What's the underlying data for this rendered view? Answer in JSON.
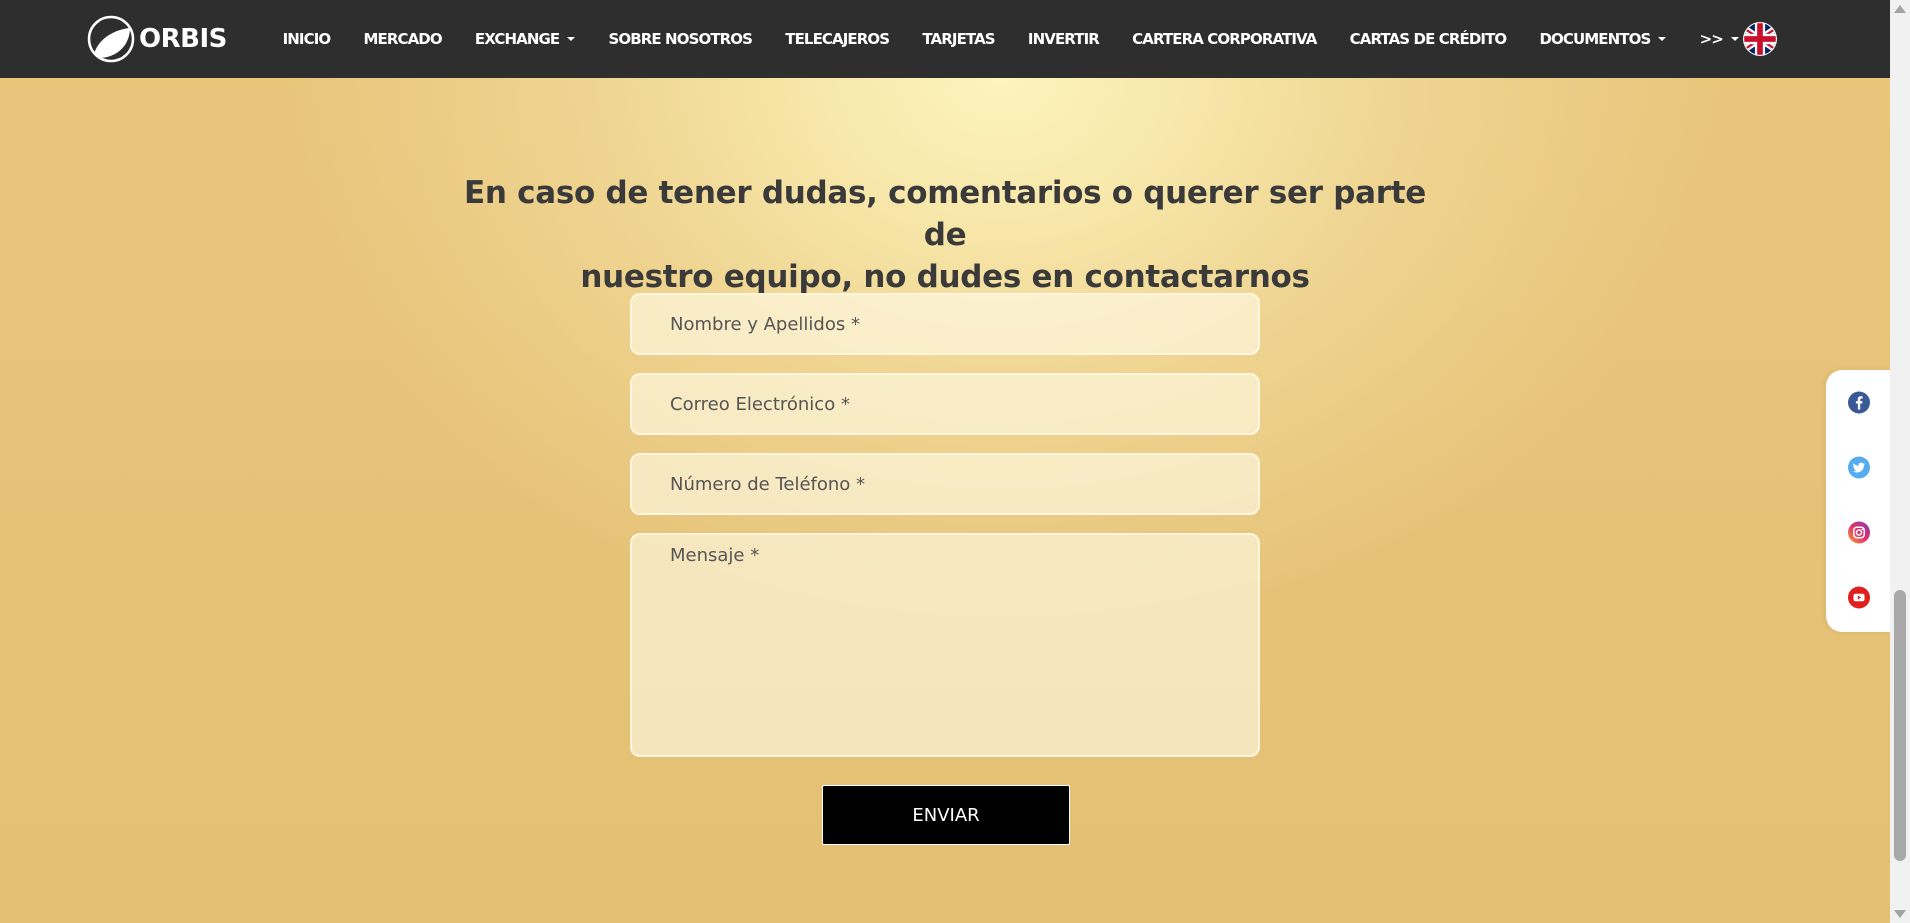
{
  "brand": {
    "name": "ORBIS"
  },
  "nav": {
    "items": [
      {
        "label": "INICIO",
        "dropdown": false
      },
      {
        "label": "MERCADO",
        "dropdown": false
      },
      {
        "label": "EXCHANGE",
        "dropdown": true
      },
      {
        "label": "SOBRE NOSOTROS",
        "dropdown": false
      },
      {
        "label": "TELECAJEROS",
        "dropdown": false
      },
      {
        "label": "TARJETAS",
        "dropdown": false
      },
      {
        "label": "INVERTIR",
        "dropdown": false
      },
      {
        "label": "CARTERA CORPORATIVA",
        "dropdown": false
      },
      {
        "label": "CARTAS DE CRÉDITO",
        "dropdown": false
      },
      {
        "label": "DOCUMENTOS",
        "dropdown": true
      },
      {
        "label": ">>",
        "dropdown": true
      }
    ],
    "language_icon": "uk-flag-icon"
  },
  "contact": {
    "heading_line1": "En caso de tener dudas, comentarios o querer ser parte de",
    "heading_line2": "nuestro equipo, no dudes en contactarnos",
    "name_placeholder": "Nombre y Apellidos *",
    "email_placeholder": "Correo Electrónico *",
    "phone_placeholder": "Número de Teléfono *",
    "message_placeholder": "Mensaje *",
    "submit_label": "ENVIAR"
  },
  "social": {
    "icons": [
      "facebook-icon",
      "twitter-icon",
      "instagram-icon",
      "youtube-icon"
    ]
  },
  "colors": {
    "navbar_bg": "#2e2e2e",
    "page_gold": "#e6c377",
    "page_highlight": "#fcf4bd",
    "submit_bg": "#000000",
    "facebook": "#3b5998",
    "twitter": "#55acee",
    "instagram": "#c13584",
    "youtube": "#e02020"
  }
}
